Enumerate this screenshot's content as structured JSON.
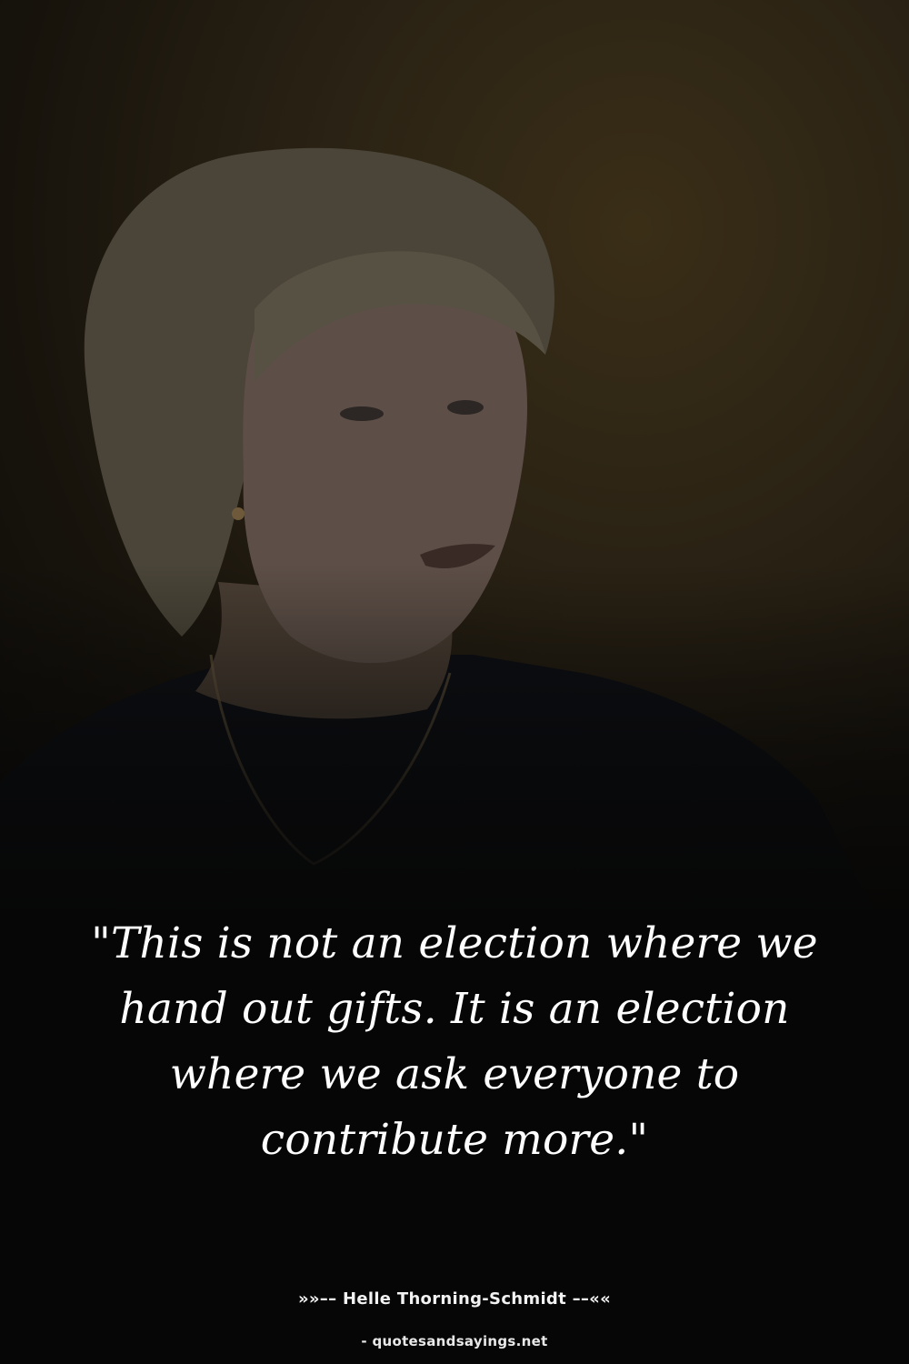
{
  "quote": {
    "text": "\"This is not an election where we hand out gifts. It is an election where we ask everyone to contribute more.\""
  },
  "attribution": {
    "text": "»»–– Helle Thorning-Schmidt ––««"
  },
  "source": {
    "text": "- quotesandsayings.net"
  },
  "colors": {
    "background": "#060606",
    "text": "#ffffff",
    "photo_tone": "#2a2214"
  }
}
